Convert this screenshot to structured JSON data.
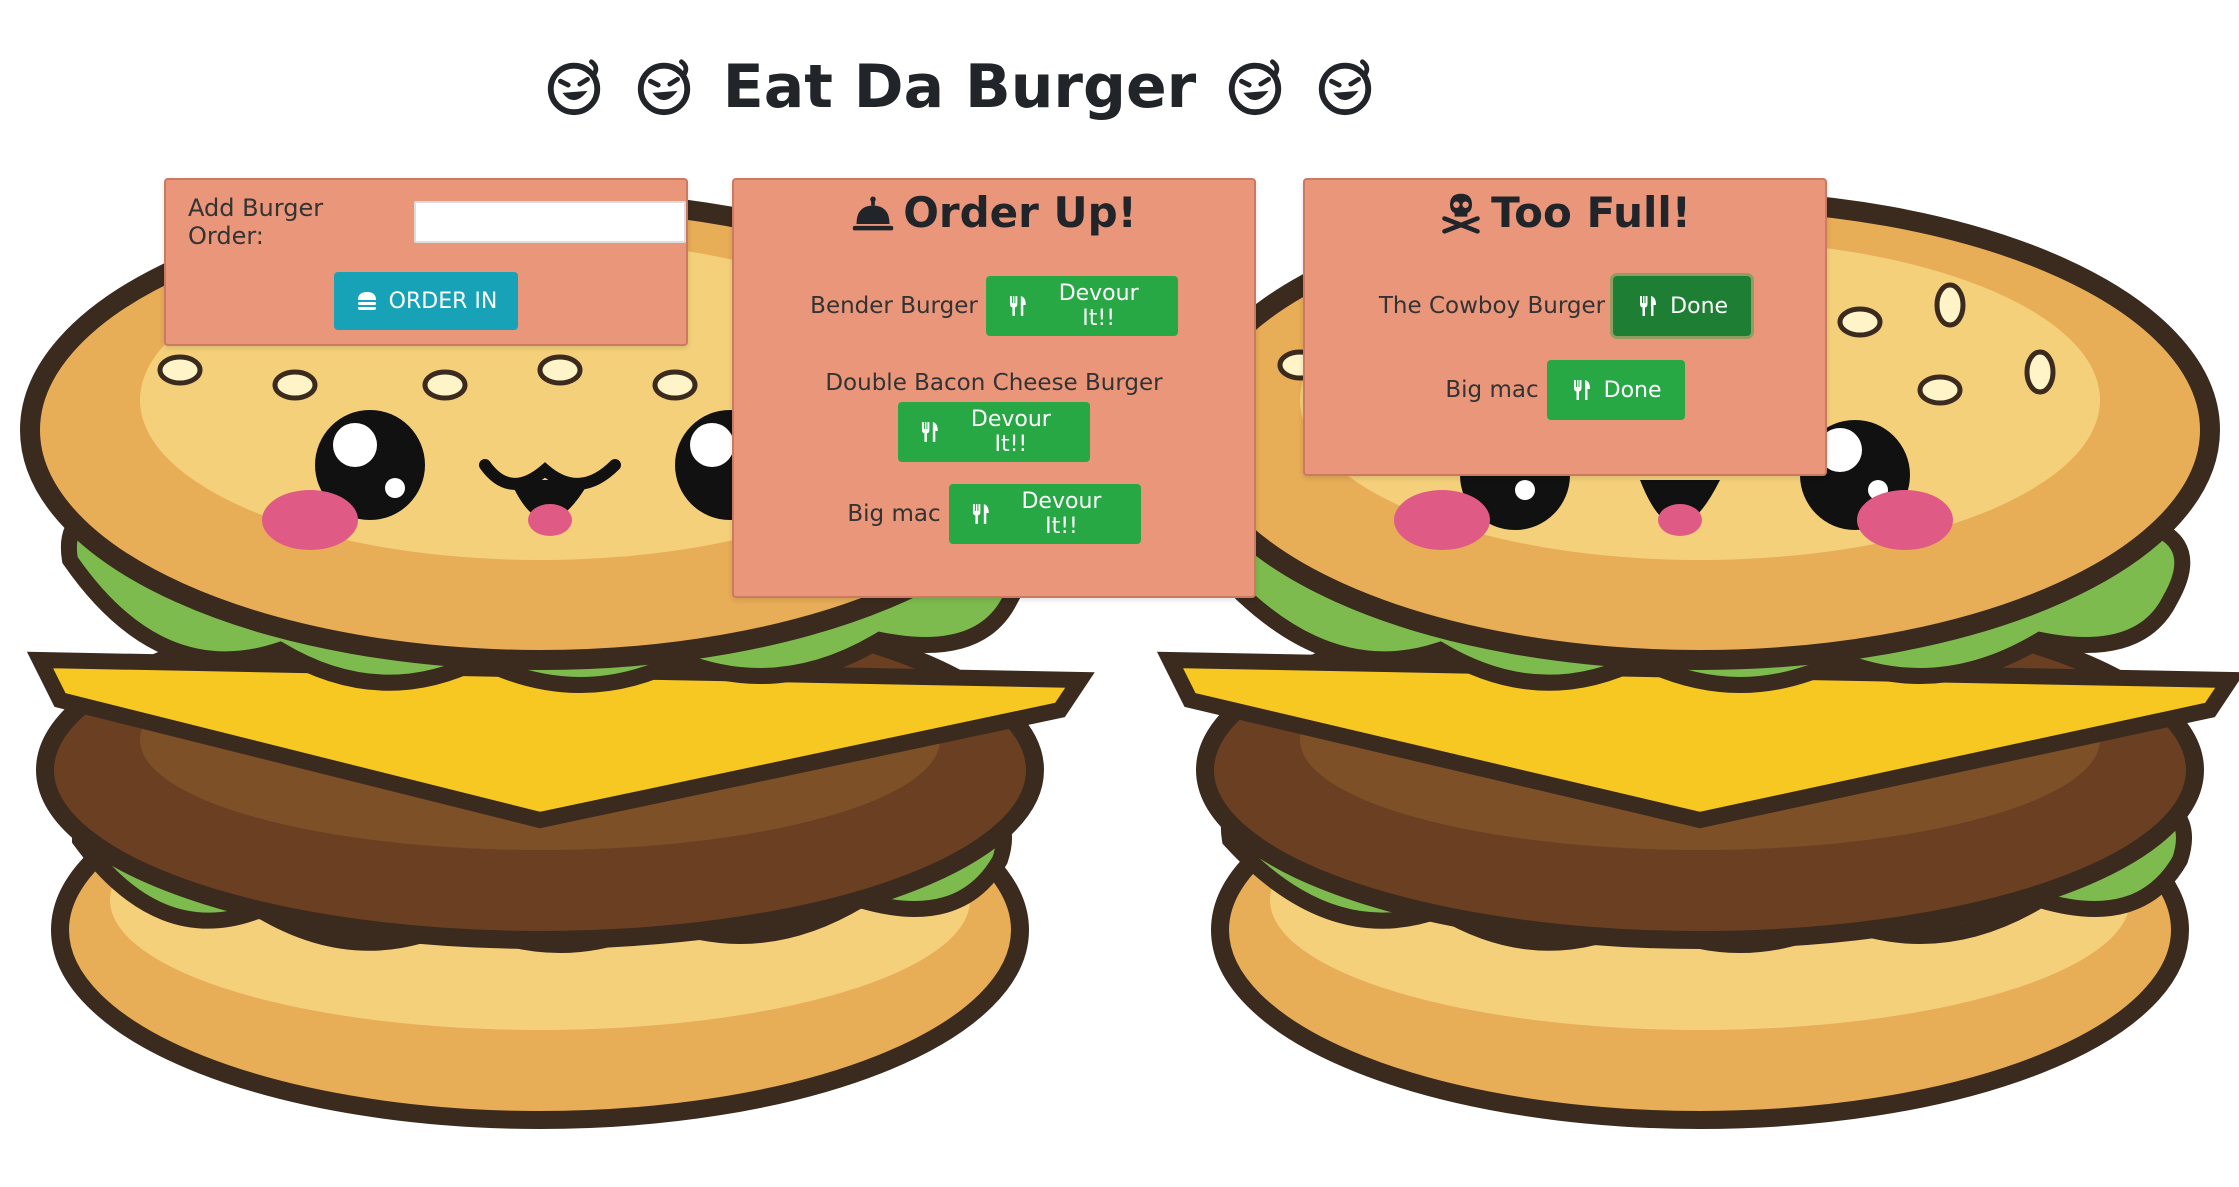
{
  "title": {
    "text": "Eat Da Burger",
    "icon": "laughing-face-icon"
  },
  "add_panel": {
    "label": "Add Burger Order:",
    "input_value": "",
    "button_label": "ORDER IN",
    "button_icon": "hamburger-icon"
  },
  "order_panel": {
    "heading": "Order Up!",
    "heading_icon": "concierge-bell-icon",
    "items": [
      {
        "name": "Bender Burger",
        "button_label": "Devour It!!"
      },
      {
        "name": "Double Bacon Cheese Burger",
        "button_label": "Devour It!!"
      },
      {
        "name": "Big mac",
        "button_label": "Devour It!!"
      }
    ],
    "button_icon": "utensils-icon"
  },
  "full_panel": {
    "heading": "Too Full!",
    "heading_icon": "skull-crossbones-icon",
    "items": [
      {
        "name": "The Cowboy Burger",
        "button_label": "Done"
      },
      {
        "name": "Big mac",
        "button_label": "Done"
      }
    ],
    "button_icon": "utensils-icon"
  },
  "colors": {
    "panel_bg": "#e9967a",
    "success": "#28a745",
    "info": "#17a2b8"
  }
}
